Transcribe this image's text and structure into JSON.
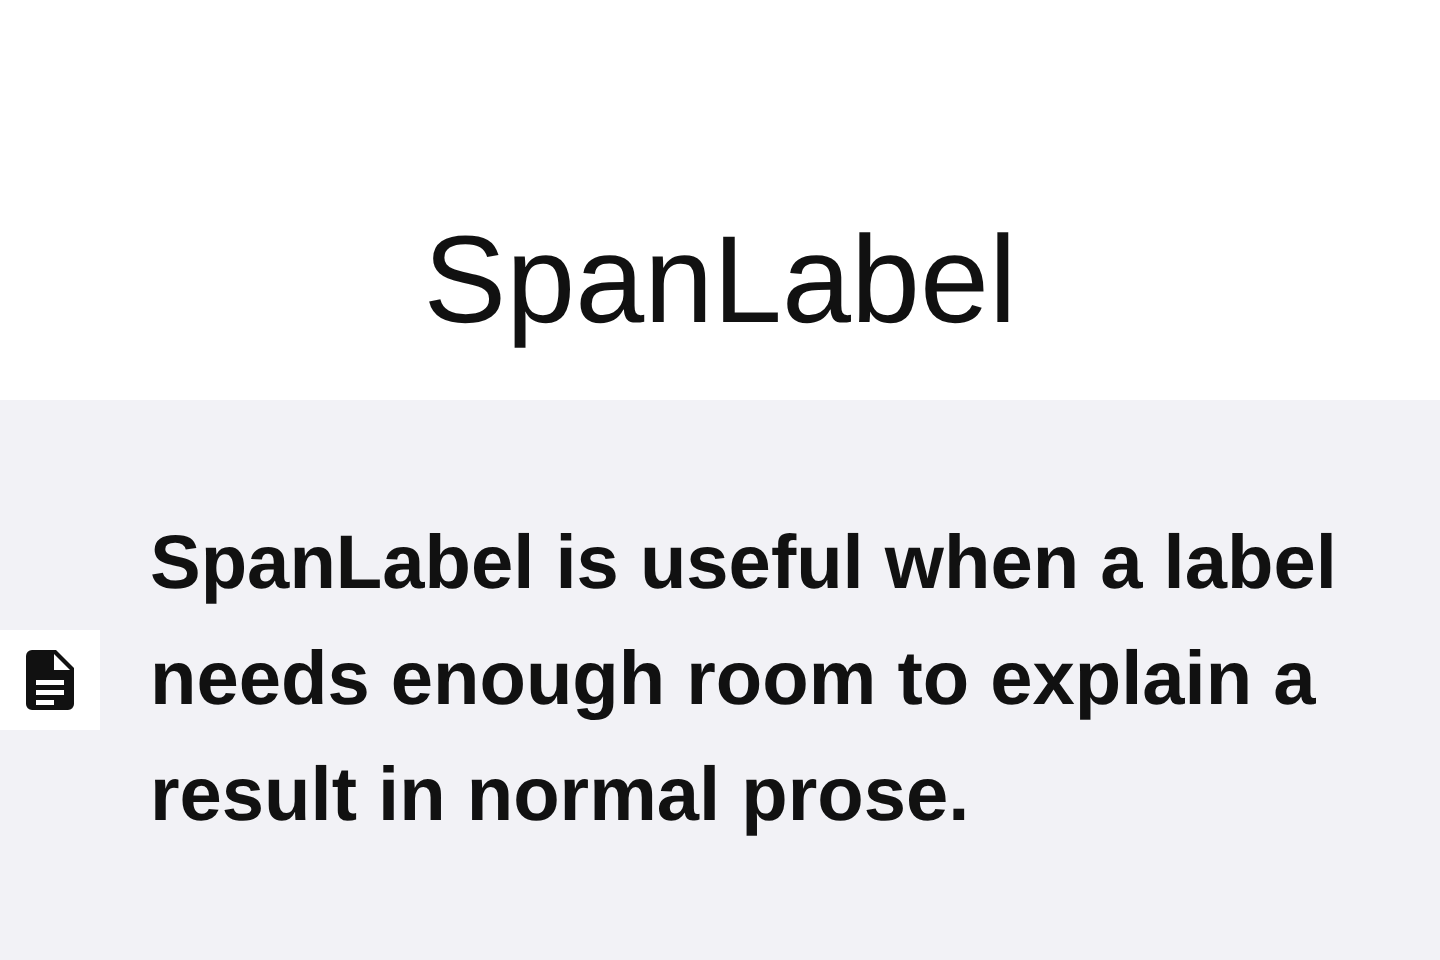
{
  "title": "SpanLabel",
  "span_label": {
    "text": "SpanLabel is useful when a label needs enough room to explain a result in normal prose."
  }
}
